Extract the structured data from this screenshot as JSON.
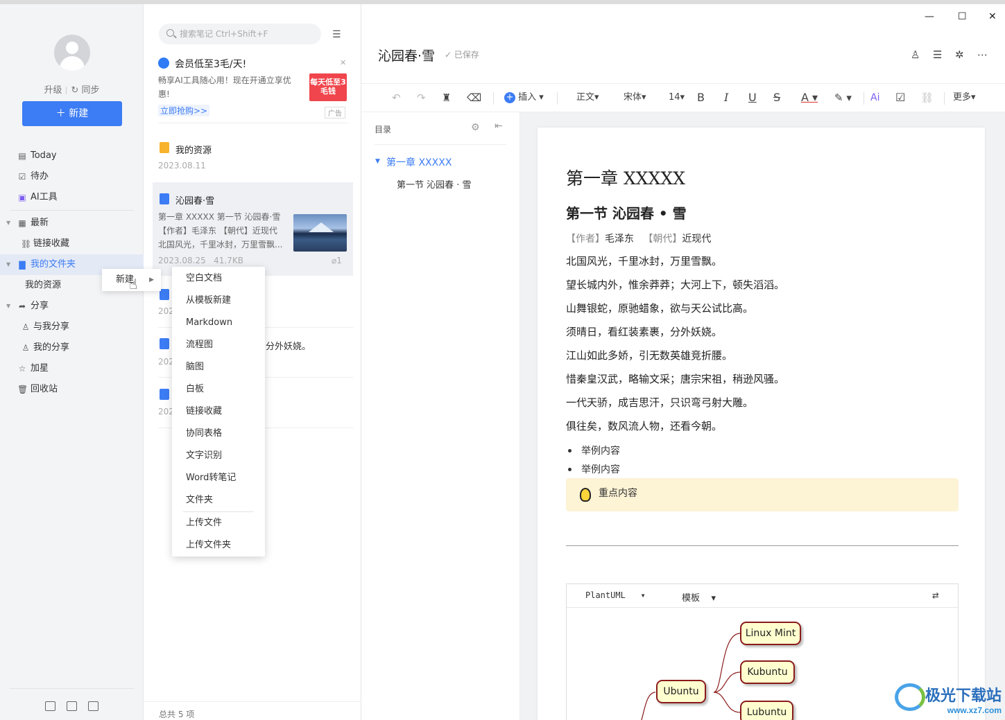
{
  "sidebar": {
    "upgrade": "升级",
    "sync": "同步",
    "new_button": "＋ 新建",
    "items": [
      {
        "label": "Today",
        "icon": "calendar-icon"
      },
      {
        "label": "待办",
        "icon": "checkbox-icon"
      },
      {
        "label": "AI工具",
        "icon": "ai-icon"
      },
      {
        "label": "最新",
        "icon": "grid-icon"
      },
      {
        "label": "链接收藏",
        "icon": "link-icon"
      },
      {
        "label": "我的文件夹",
        "icon": "folder-icon"
      },
      {
        "label": "我的资源"
      },
      {
        "label": "分享",
        "icon": "share-icon"
      },
      {
        "label": "与我分享",
        "icon": "user-icon"
      },
      {
        "label": "我的分享",
        "icon": "user-icon"
      },
      {
        "label": "加星",
        "icon": "star-icon"
      },
      {
        "label": "回收站",
        "icon": "trash-icon"
      }
    ]
  },
  "list": {
    "search_placeholder": "搜索笔记 Ctrl+Shift+F",
    "promo": {
      "title": "会员低至3毛/天!",
      "desc": "畅享AI工具随心用！现在开通立享优惠!",
      "link": "立即抢购>>",
      "badge": "每天低至3毛钱",
      "ad": "广告"
    },
    "items": [
      {
        "title": "我的资源",
        "date": "2023.08.11"
      },
      {
        "title": "沁园春·雪",
        "summary": "第一章 XXXXX 第一节 沁园春·雪 【作者】毛泽东 【朝代】近现代 北国风光，千里冰封，万里雪飘...",
        "date": "2023.08.25",
        "size": "41.7KB",
        "attach": "1"
      },
      {
        "date": "202"
      },
      {
        "date": "202",
        "summary": "分外妖娆。"
      },
      {
        "date": "202"
      }
    ],
    "footer": "总共 5 项"
  },
  "context_menu": {
    "parent": "新建",
    "items": [
      "空白文档",
      "从模板新建",
      "Markdown",
      "流程图",
      "脑图",
      "白板",
      "链接收藏",
      "协同表格",
      "文字识别",
      "Word转笔记",
      "文件夹",
      "上传文件",
      "上传文件夹"
    ]
  },
  "editor": {
    "title": "沁园春·雪",
    "saved": "已保存",
    "toolbar": {
      "insert": "插入",
      "style": "正文",
      "font": "宋体",
      "size": "14",
      "more": "更多"
    },
    "toc": {
      "header": "目录",
      "h1": "第一章  XXXXX",
      "h2": "第一节  沁园春 · 雪"
    },
    "doc": {
      "chapter": "第一章  XXXXX",
      "section": "第一节  沁园春 • 雪",
      "author_label": "【作者】",
      "author": "毛泽东",
      "dynasty_label": "【朝代】",
      "dynasty": "近现代",
      "lines": [
        "北国风光，千里冰封，万里雪飘。",
        "望长城内外，惟余莽莽；大河上下，顿失滔滔。",
        "山舞银蛇，原驰蜡象，欲与天公试比高。",
        "须晴日，看红装素裹，分外妖娆。",
        "江山如此多娇，引无数英雄竞折腰。",
        "惜秦皇汉武，略输文采；唐宗宋祖，稍逊风骚。",
        "一代天骄，成吉思汗，只识弯弓射大雕。",
        "俱往矣，数风流人物，还看今朝。"
      ],
      "bullets": [
        "举例内容",
        "举例内容"
      ],
      "callout": "重点内容",
      "uml": {
        "lang": "PlantUML",
        "template": "模板",
        "nodes": [
          "Linux Mint",
          "Kubuntu",
          "Ubuntu",
          "Lubuntu"
        ]
      }
    }
  },
  "watermark": {
    "name": "极光下载站",
    "url": "www.xz7.com"
  }
}
